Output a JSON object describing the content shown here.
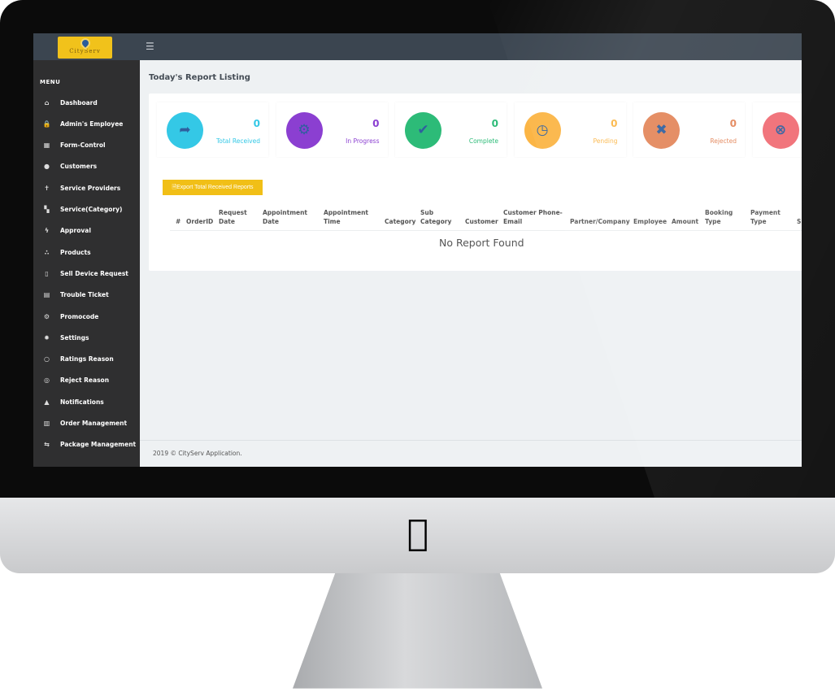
{
  "app": {
    "logo_text": "CityServ",
    "menu_label": "MENU"
  },
  "sidebar": {
    "items": [
      {
        "label": "Dashboard",
        "icon": "home-icon"
      },
      {
        "label": "Admin's Employee",
        "icon": "lock-icon"
      },
      {
        "label": "Form-Control",
        "icon": "table-icon"
      },
      {
        "label": "Customers",
        "icon": "user-icon"
      },
      {
        "label": "Service Providers",
        "icon": "person-icon"
      },
      {
        "label": "Service(Category)",
        "icon": "grid-icon"
      },
      {
        "label": "Approval",
        "icon": "bolt-icon"
      },
      {
        "label": "Products",
        "icon": "dots-icon"
      },
      {
        "label": "Sell Device Request",
        "icon": "mobile-icon"
      },
      {
        "label": "Trouble Ticket",
        "icon": "film-icon"
      },
      {
        "label": "Promocode",
        "icon": "cogs-icon"
      },
      {
        "label": "Settings",
        "icon": "gear-icon"
      },
      {
        "label": "Ratings Reason",
        "icon": "circle-icon"
      },
      {
        "label": "Reject Reason",
        "icon": "settings-circle-icon"
      },
      {
        "label": "Notifications",
        "icon": "bell-icon"
      },
      {
        "label": "Order Management",
        "icon": "calendar-icon"
      },
      {
        "label": "Package Management",
        "icon": "retweet-icon"
      }
    ]
  },
  "main": {
    "title": "Today's Report Listing",
    "stats": [
      {
        "value": "0",
        "label": "Total Received",
        "color": "#34c8e6",
        "icon": "share-icon"
      },
      {
        "value": "0",
        "label": "In Progress",
        "color": "#8b3fd1",
        "icon": "cogs-icon"
      },
      {
        "value": "0",
        "label": "Complete",
        "color": "#2dbb78",
        "icon": "check-icon"
      },
      {
        "value": "0",
        "label": "Pending",
        "color": "#fbb545",
        "icon": "clock-icon"
      },
      {
        "value": "0",
        "label": "Rejected",
        "color": "#e3865a",
        "icon": "x-icon"
      },
      {
        "value": "",
        "label": "",
        "color": "#f06c74",
        "icon": "x-circle-icon"
      }
    ],
    "export_label": "Export Total Received Reports",
    "table": {
      "columns": [
        "#",
        "OrderID",
        "Request Date",
        "Appointment Date",
        "Appointment Time",
        "Category",
        "Sub Category",
        "Customer",
        "Customer Phone-Email",
        "Partner/Company",
        "Employee",
        "Amount",
        "Booking Type",
        "Payment Type",
        "S"
      ],
      "empty_text": "No Report Found"
    },
    "footer": "2019 © CityServ Application."
  }
}
